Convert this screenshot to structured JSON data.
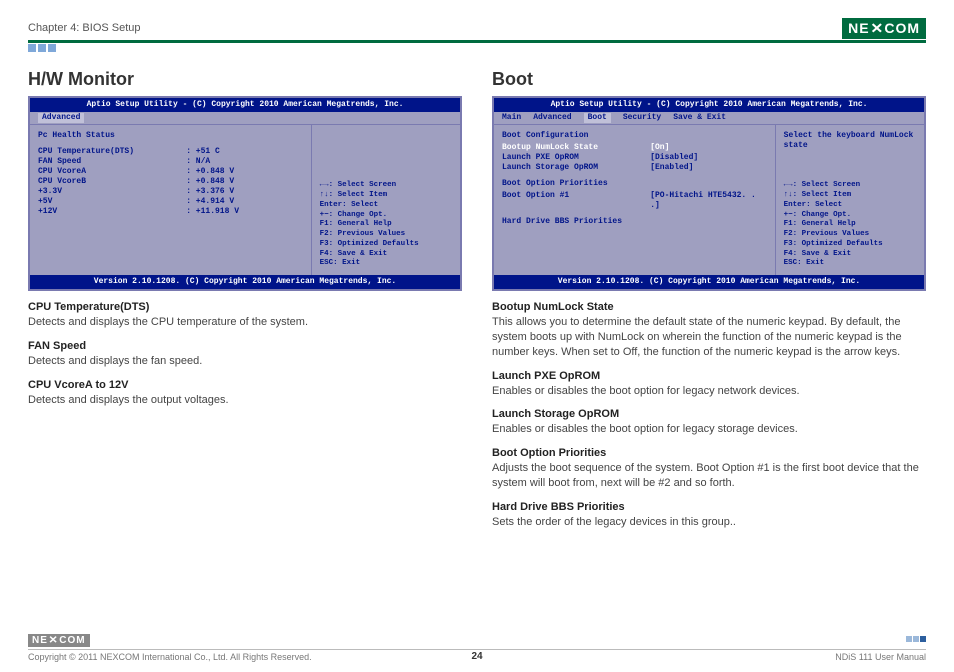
{
  "page": {
    "chapter": "Chapter 4: BIOS Setup",
    "brand": "NEXCOM",
    "pageNumber": "24",
    "copyright": "Copyright © 2011 NEXCOM International Co., Ltd. All Rights Reserved.",
    "manual": "NDiS 111 User Manual"
  },
  "hw": {
    "title": "H/W Monitor",
    "bios": {
      "titlebar": "Aptio Setup Utility - (C) Copyright 2010 American Megatrends, Inc.",
      "tabs": {
        "advanced": "Advanced"
      },
      "header": "Pc Health Status",
      "rows": [
        {
          "k": "CPU Temperature(DTS)",
          "v": ": +51 C"
        },
        {
          "k": "FAN Speed",
          "v": ": N/A"
        },
        {
          "k": "CPU VcoreA",
          "v": ": +0.848 V"
        },
        {
          "k": "CPU VcoreB",
          "v": ": +0.848 V"
        },
        {
          "k": "+3.3V",
          "v": ": +3.376 V"
        },
        {
          "k": "+5V",
          "v": ": +4.914 V"
        },
        {
          "k": "+12V",
          "v": ": +11.918 V"
        }
      ],
      "help": [
        "←→: Select Screen",
        "↑↓:   Select Item",
        "Enter: Select",
        "+−:   Change Opt.",
        "F1:   General Help",
        "F2:   Previous Values",
        "F3:   Optimized Defaults",
        "F4:   Save & Exit",
        "ESC: Exit"
      ],
      "footer": "Version 2.10.1208. (C) Copyright 2010 American Megatrends, Inc."
    },
    "desc": [
      {
        "h": "CPU Temperature(DTS)",
        "p": "Detects and displays the CPU temperature of the system."
      },
      {
        "h": "FAN Speed",
        "p": "Detects and displays the fan speed."
      },
      {
        "h": "CPU VcoreA to 12V",
        "p": "Detects and displays the output voltages."
      }
    ]
  },
  "boot": {
    "title": "Boot",
    "bios": {
      "titlebar": "Aptio Setup Utility - (C) Copyright 2010 American Megatrends, Inc.",
      "tabs": {
        "main": "Main",
        "advanced": "Advanced",
        "boot": "Boot",
        "security": "Security",
        "save": "Save & Exit"
      },
      "cfgHeader": "Boot Configuration",
      "rows1": [
        {
          "k": "Bootup NumLock State",
          "v": "[On]",
          "hl": true
        },
        {
          "k": "Launch PXE OpROM",
          "v": "[Disabled]"
        },
        {
          "k": "Launch Storage OpROM",
          "v": "[Enabled]"
        }
      ],
      "prioHeader": "Boot Option Priorities",
      "rows2": [
        {
          "k": "Boot Option #1",
          "v": "[PO-Hitachi HTE5432. . .]"
        }
      ],
      "bbs": "Hard Drive BBS Priorities",
      "rightTop": "Select the keyboard NumLock state",
      "help": [
        "←→: Select Screen",
        "↑↓:   Select Item",
        "Enter: Select",
        "+−:   Change Opt.",
        "F1:   General Help",
        "F2:   Previous Values",
        "F3:   Optimized Defaults",
        "F4:   Save & Exit",
        "ESC: Exit"
      ],
      "footer": "Version 2.10.1208. (C) Copyright 2010 American Megatrends, Inc."
    },
    "desc": [
      {
        "h": "Bootup NumLock State",
        "p": "This allows you to determine the default state of the numeric keypad. By default, the system boots up with NumLock on wherein the function of the numeric keypad is the number keys. When set to Off, the function of the numeric keypad is the arrow keys."
      },
      {
        "h": "Launch PXE OpROM",
        "p": "Enables or disables the boot option for legacy network devices."
      },
      {
        "h": "Launch Storage OpROM",
        "p": "Enables or disables the boot option for legacy storage devices."
      },
      {
        "h": "Boot Option Priorities",
        "p": "Adjusts the boot sequence of the system. Boot Option #1 is the first boot device that the system will boot from, next will be #2 and so forth."
      },
      {
        "h": "Hard Drive BBS Priorities",
        "p": "Sets the order of the legacy devices in this group.."
      }
    ]
  }
}
